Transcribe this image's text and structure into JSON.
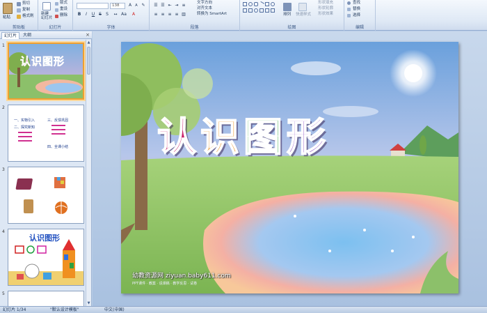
{
  "ribbon": {
    "groups": [
      {
        "label": "剪贴板"
      },
      {
        "label": "幻灯片"
      },
      {
        "label": "字体"
      },
      {
        "label": "段落"
      },
      {
        "label": "绘图"
      },
      {
        "label": "编辑"
      }
    ],
    "paste": "粘贴",
    "cut": "剪切",
    "copy": "复制",
    "format_painter": "格式刷",
    "new_slide": "新建\n幻灯片",
    "layout": "版式",
    "reset": "重设",
    "delete": "删除",
    "font_size": "138",
    "text_direction": "文字方向",
    "align_text": "对齐文本",
    "smartart": "转换为 SmartArt",
    "arrange": "排列",
    "quick_styles": "快速样式",
    "shape_fill": "形状填充",
    "shape_outline": "形状轮廓",
    "shape_effects": "形状效果",
    "find": "查找",
    "replace": "替换",
    "select": "选择"
  },
  "panel": {
    "tab_slides": "幻灯片",
    "tab_outline": "大纲",
    "close": "×"
  },
  "slides": [
    {
      "num": "1",
      "title": "认识图形"
    },
    {
      "num": "2",
      "items_left": [
        "一、实物引入",
        "二、探究新知"
      ],
      "items_right": [
        "三、反馈巩固",
        "四、全课小结"
      ]
    },
    {
      "num": "3"
    },
    {
      "num": "4",
      "title": "认识图形"
    },
    {
      "num": "5"
    }
  ],
  "main_slide": {
    "title_chars": [
      "认",
      "识",
      "图",
      "形"
    ],
    "title_colors": [
      "#c8206a",
      "#e88a10",
      "#28a83c",
      "#7a2fb8"
    ],
    "watermark": "幼教资源网 ziyuan.baby611.com",
    "watermark_sub": "PPT课件 · 教案 · 说课稿 · 教学反思 · 试卷"
  },
  "status": {
    "slide_info": "幻灯片 1/34",
    "theme": "\"默认设计模板\"",
    "language": "中文(中国)"
  }
}
